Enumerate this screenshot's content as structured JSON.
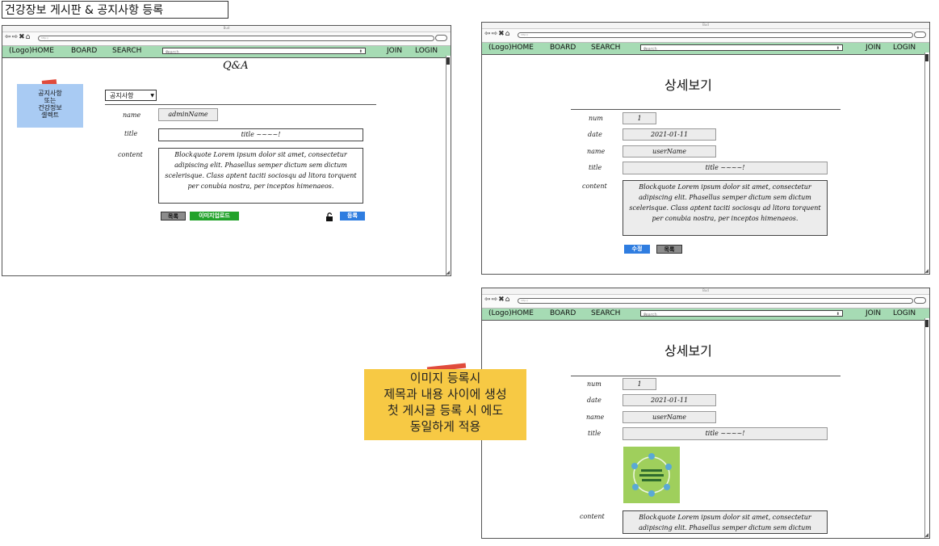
{
  "page_title": "건강장보 게시판 & 공지사항  등록",
  "browser": {
    "nav": {
      "home": "(Logo)HOME",
      "board": "BOARD",
      "search": "SEARCH",
      "search_placeholder": "search",
      "join": "JOIN",
      "login": "LOGIN"
    }
  },
  "write_form": {
    "heading": "Q&A",
    "select_value": "공지사항",
    "name_label": "name",
    "name_value": "adminName",
    "title_label": "title",
    "title_value": "title ~~~~!",
    "content_label": "content",
    "content_value": "Blockquote  Lorem ipsum dolor sit amet, consectetur adipiscing elit. Phasellus semper dictum sem dictum scelerisque. Class aptent taciti sociosqu ad litora torquent per conubia nostra, per inceptos himenaeos.",
    "list_button": "목록",
    "image_upload_button": "이미지업로드",
    "submit_button": "등록"
  },
  "note_select": "공지사항\n또는\n건강정보\n셀렉트",
  "detail_view": {
    "heading": "상세보기",
    "num_label": "num",
    "num_value": "1",
    "date_label": "date",
    "date_value": "2021-01-11",
    "name_label": "name",
    "name_value": "userName",
    "title_label": "title",
    "title_value": "title ~~~~!",
    "content_label": "content",
    "content_value": "Blockquote  Lorem ipsum dolor sit amet, consectetur adipiscing elit. Phasellus semper dictum sem dictum scelerisque. Class aptent taciti sociosqu ad litora torquent per conubia nostra, per inceptos himenaeos.",
    "edit_button": "수정",
    "list_button": "목록"
  },
  "detail_image_view": {
    "heading": "상세보기",
    "num_label": "num",
    "num_value": "1",
    "date_label": "date",
    "date_value": "2021-01-11",
    "name_label": "name",
    "name_value": "userName",
    "title_label": "title",
    "title_value": "title ~~~~!",
    "content_label": "content",
    "content_value": "Blockquote  Lorem ipsum dolor sit amet, consectetur adipiscing elit. Phasellus semper dictum sem dictum scelerisque. Class"
  },
  "note_image": "이미지 등록시\n제목과 내용 사이에 생성\n첫 게시글 등록 시 에도\n동일하게 적용",
  "colors": {
    "nav_bg": "#a6dbb4",
    "note_blue": "#a9cbf3",
    "note_yellow": "#f7c944",
    "btn_blue": "#2f7de0",
    "btn_green": "#22a22a"
  }
}
